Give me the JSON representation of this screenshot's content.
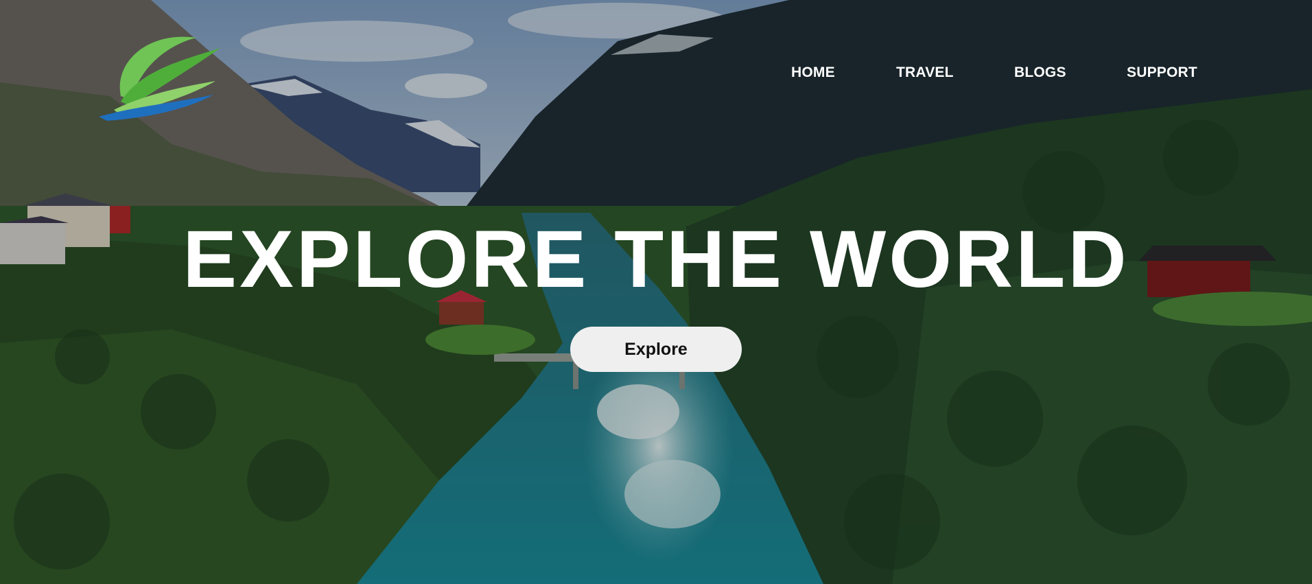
{
  "brand": {
    "logo_icon": "leaf-swoosh-logo-icon",
    "colors": {
      "logo_green_light": "#8fd16a",
      "logo_green": "#4fae3a",
      "logo_blue": "#1f6fbf"
    }
  },
  "nav": {
    "items": [
      {
        "label": "HOME"
      },
      {
        "label": "TRAVEL"
      },
      {
        "label": "BLOGS"
      },
      {
        "label": "SUPPORT"
      }
    ]
  },
  "hero": {
    "headline": "EXPLORE THE WORLD",
    "cta_label": "Explore",
    "background": "fjord-valley-river-photo"
  }
}
